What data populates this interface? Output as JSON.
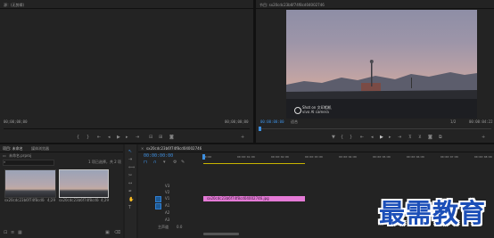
{
  "source_monitor": {
    "title": "源：(无剪辑)",
    "timecode_left": "00;00;00;00",
    "timecode_right": "00;00;00;00"
  },
  "program_monitor": {
    "title": "节目: sx20cdc23b6f74f8cd04002746",
    "timecode": "00:00:00:00",
    "fit": "适合",
    "ratio": "1/2",
    "end_timecode": "00:00:04:22",
    "overlay_line1": "Shot on 文印相机",
    "overlay_line2": "vivo AI camera"
  },
  "project_panel": {
    "tab_project": "项目: 未命名",
    "tab_browser": "媒体浏览器",
    "file_name": "未命名.prproj",
    "selected_info": "1 项已选择，共 2 项",
    "items": [
      {
        "name": "sx20cdc23b6f74f8cd04002746.jpg",
        "duration": "4;29"
      },
      {
        "name": "sx20cdc23b6f74f8cd04002746.jpg",
        "duration": "4;29"
      }
    ]
  },
  "timeline": {
    "tab": "sx20cdc23b6f74f8cd04002746",
    "timecode": "00:00:00:00",
    "ruler": [
      "00:00",
      "00:00:01:00",
      "00:00:02:00",
      "00:00:03:00",
      "00:00:04:00",
      "00:00:05:00",
      "00:00:06:00",
      "00:00:07:00",
      "00:00:08:00"
    ],
    "video_tracks": [
      "V3",
      "V2",
      "V1"
    ],
    "audio_tracks": [
      "A1",
      "A2",
      "A3"
    ],
    "master": "主声道",
    "master_value": "0.0",
    "clip_label": "sx20cdc23b6f74f8cd04002746.jpg",
    "clip_color": "#e47ad6"
  },
  "watermark": "最需教育"
}
